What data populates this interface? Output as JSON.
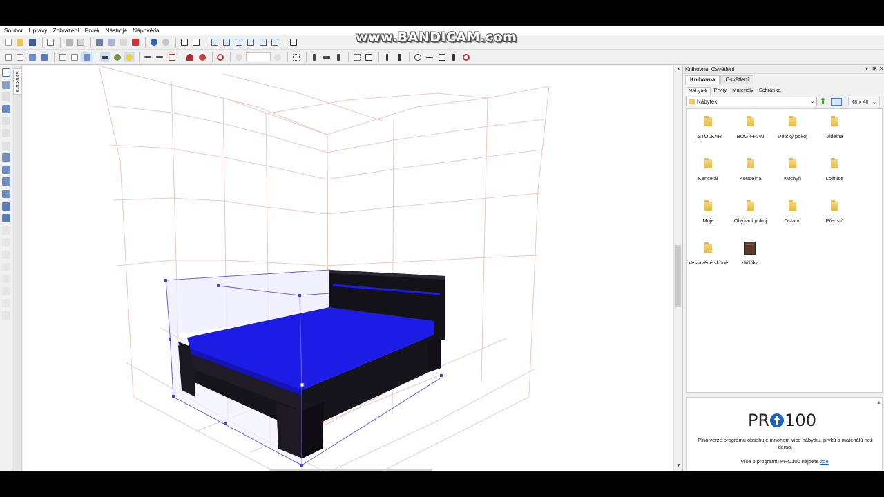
{
  "menu": [
    "Soubor",
    "Úpravy",
    "Zobrazení",
    "Prvek",
    "Nástroje",
    "Nápověda"
  ],
  "watermark": "www.BANDICAM.com",
  "left_tab": "Struktura",
  "panel": {
    "title": "Knihovna, Osvětlení",
    "controls": [
      "▾",
      "⊞",
      "✕"
    ],
    "tabs": [
      "Knihovna",
      "Osvětlení"
    ],
    "active_tab": "Knihovna",
    "subtabs": [
      "Nábytek",
      "Prvky",
      "Materiály",
      "Schránka"
    ],
    "active_subtab": "Nábytek",
    "path": "Nábytek",
    "icon_size": "48 x 48",
    "items": [
      {
        "label": "_STOLKAR",
        "icon": "folder-icon"
      },
      {
        "label": "BOG-FRAN",
        "icon": "folder-icon"
      },
      {
        "label": "Dětský pokoj",
        "icon": "folder-icon"
      },
      {
        "label": "Jídelna",
        "icon": "folder-icon"
      },
      {
        "label": "Kancelář",
        "icon": "folder-icon"
      },
      {
        "label": "Koupelna",
        "icon": "folder-icon"
      },
      {
        "label": "Kuchyň",
        "icon": "folder-icon"
      },
      {
        "label": "Ložnice",
        "icon": "folder-icon"
      },
      {
        "label": "Moje",
        "icon": "folder-icon"
      },
      {
        "label": "Obývací pokoj",
        "icon": "folder-icon"
      },
      {
        "label": "Ostatní",
        "icon": "folder-icon"
      },
      {
        "label": "Předsíň",
        "icon": "folder-icon"
      },
      {
        "label": "Vestavěné skříně",
        "icon": "folder-icon"
      },
      {
        "label": "skříňka",
        "icon": "cabinet-icon"
      }
    ]
  },
  "promo": {
    "logo_left": "PR",
    "logo_right": "100",
    "text": "Plná verze programu obsahuje mnohem více nábytku, prvků a materiálů než demo.",
    "more_prefix": "Více o programu PRO100 najdete ",
    "more_link": "zde"
  },
  "colors": {
    "mattress": "#1c1ce6",
    "frame": "#15131a",
    "grid": "#e6bfb8",
    "selection": "#5a55d6"
  }
}
